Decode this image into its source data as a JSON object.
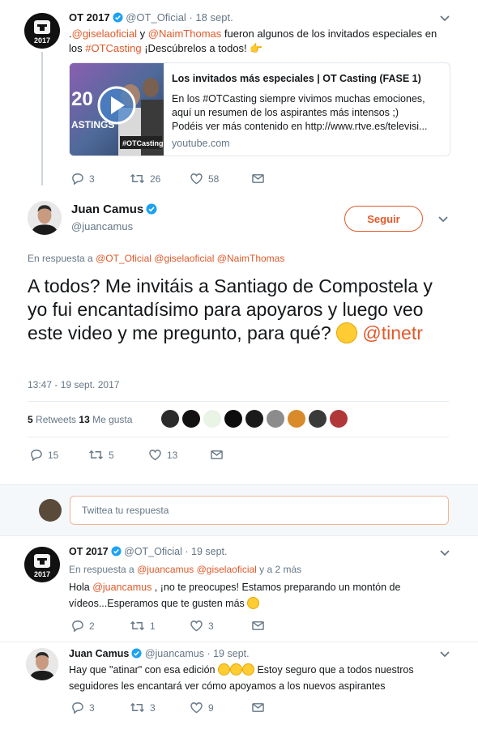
{
  "tweet1": {
    "name": "OT 2017",
    "handle": "@OT_Oficial",
    "date": "18 sept.",
    "text_prefix": ".",
    "mention1": "@giselaoficial",
    "and": " y ",
    "mention2": "@NaimThomas",
    "text_mid": " fueron algunos de los invitados especiales en los ",
    "hashtag": "#OTCasting",
    "text_end": " ¡Descúbrelos a todos! 👉",
    "card": {
      "title": "Los invitados más especiales | OT Casting (FASE 1)",
      "desc_line1": "En los #OTCasting siempre vivimos muchas emociones,",
      "desc_line2": "aquí un resumen de los aspirantes más intensos ;)",
      "desc_line3": "Podéis ver más contenido en http://www.rtve.es/televisi...",
      "domain": "youtube.com",
      "thumb_text1": "20",
      "thumb_text2": "ASTINGS",
      "thumb_tag": "#OTCasting"
    },
    "replies": "3",
    "retweets": "26",
    "likes": "58"
  },
  "main": {
    "name": "Juan Camus",
    "handle": "@juancamus",
    "follow_label": "Seguir",
    "reply_prefix": "En respuesta a ",
    "reply_mentions": "@OT_Oficial @giselaoficial @NaimThomas",
    "text": "A todos? Me invitáis a Santiago de Compostela y yo fui encantadísimo para apoyaros y luego veo este video y me pregunto, para qué? ",
    "mention": " @tinetr",
    "timestamp": "13:47 - 19 sept. 2017",
    "retweets_count": "5",
    "retweets_label": " Retweets  ",
    "likes_count": "13",
    "likes_label": " Me gusta",
    "replies": "15",
    "retweets": "5",
    "likes": "13"
  },
  "composer": {
    "placeholder": "Twittea tu respuesta"
  },
  "reply1": {
    "name": "OT 2017",
    "handle": "@OT_Oficial",
    "date": "19 sept.",
    "reply_prefix": "En respuesta a ",
    "reply_mentions": "@juancamus @giselaoficial",
    "reply_suffix": " y a 2 más",
    "greet": "Hola ",
    "mention": "@juancamus",
    "line1_end": " , ¡no te preocupes! Estamos preparando un montón de",
    "line2": "vídeos...Esperamos que te gusten más ",
    "replies": "2",
    "retweets": "1",
    "likes": "3"
  },
  "reply2": {
    "name": "Juan Camus",
    "handle": "@juancamus",
    "date": "19 sept.",
    "line1_start": "Hay que \"atinar\" con esa edición ",
    "line1_end": " Estoy seguro que a todos nuestros",
    "line2": "seguidores les encantará ver cómo apoyamos a los nuevos aspirantes",
    "replies": "3",
    "retweets": "3",
    "likes": "9"
  },
  "colors": {
    "accent": "#e0592a",
    "muted": "#657786",
    "verified": "#1da1f2"
  },
  "icons": [
    "reply-icon",
    "retweet-icon",
    "like-icon",
    "message-icon",
    "chevron-down-icon",
    "verified-icon",
    "play-icon"
  ]
}
